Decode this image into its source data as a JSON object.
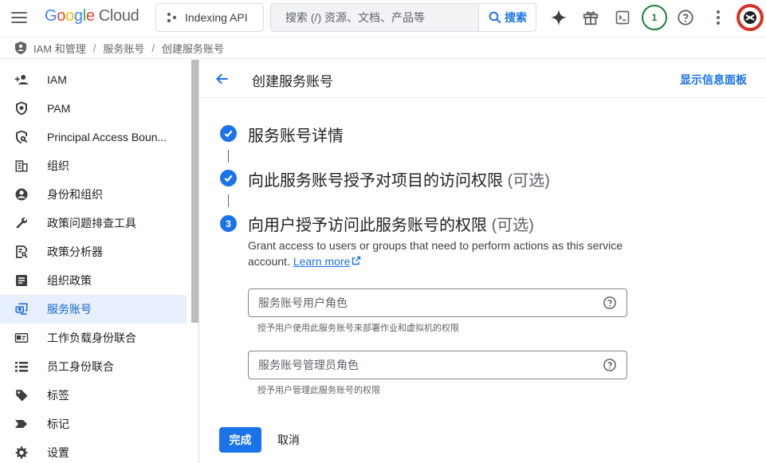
{
  "header": {
    "logo_google": [
      "G",
      "o",
      "o",
      "g",
      "l",
      "e"
    ],
    "logo_cloud": "Cloud",
    "project": "Indexing API",
    "search_placeholder": "搜索 (/) 资源、文档、产品等",
    "search_button": "搜索",
    "notification_count": "1"
  },
  "breadcrumb": {
    "items": [
      "IAM 和管理",
      "服务账号",
      "创建服务账号"
    ],
    "separator": "/"
  },
  "sidebar": {
    "items": [
      {
        "label": "IAM",
        "icon": "person-add-icon"
      },
      {
        "label": "PAM",
        "icon": "shield-icon"
      },
      {
        "label": "Principal Access Boun...",
        "icon": "shield-search-icon"
      },
      {
        "label": "组织",
        "icon": "building-icon"
      },
      {
        "label": "身份和组织",
        "icon": "account-circle-icon"
      },
      {
        "label": "政策问题排查工具",
        "icon": "wrench-icon"
      },
      {
        "label": "政策分析器",
        "icon": "document-search-icon"
      },
      {
        "label": "组织政策",
        "icon": "article-icon"
      },
      {
        "label": "服务账号",
        "icon": "service-account-icon",
        "active": true
      },
      {
        "label": "工作负载身份联合",
        "icon": "id-card-icon"
      },
      {
        "label": "员工身份联合",
        "icon": "list-icon"
      },
      {
        "label": "标签",
        "icon": "tag-icon"
      },
      {
        "label": "标记",
        "icon": "label-icon"
      },
      {
        "label": "设置",
        "icon": "settings-icon"
      }
    ]
  },
  "page": {
    "title": "创建服务账号",
    "info_panel": "显示信息面板",
    "steps": [
      {
        "title": "服务账号详情",
        "optional": "",
        "status": "done"
      },
      {
        "title": "向此服务账号授予对项目的访问权限",
        "optional": "(可选)",
        "status": "done"
      },
      {
        "title": "向用户授予访问此服务账号的权限",
        "optional": "(可选)",
        "status": "current",
        "number": "3"
      }
    ],
    "step3_desc": "Grant access to users or groups that need to perform actions as this service account.",
    "learn_more": "Learn more",
    "field1": {
      "placeholder": "服务账号用户角色",
      "hint": "授予用户使用此服务账号来部署作业和虚拟机的权限"
    },
    "field2": {
      "placeholder": "服务账号管理员角色",
      "hint": "授予用户管理此服务账号的权限"
    },
    "done_button": "完成",
    "cancel_button": "取消"
  },
  "colors": {
    "accent": "#1a73e8",
    "active_bg": "#e8f0fe",
    "badge_green": "#188038",
    "avatar_red": "#d93025"
  }
}
